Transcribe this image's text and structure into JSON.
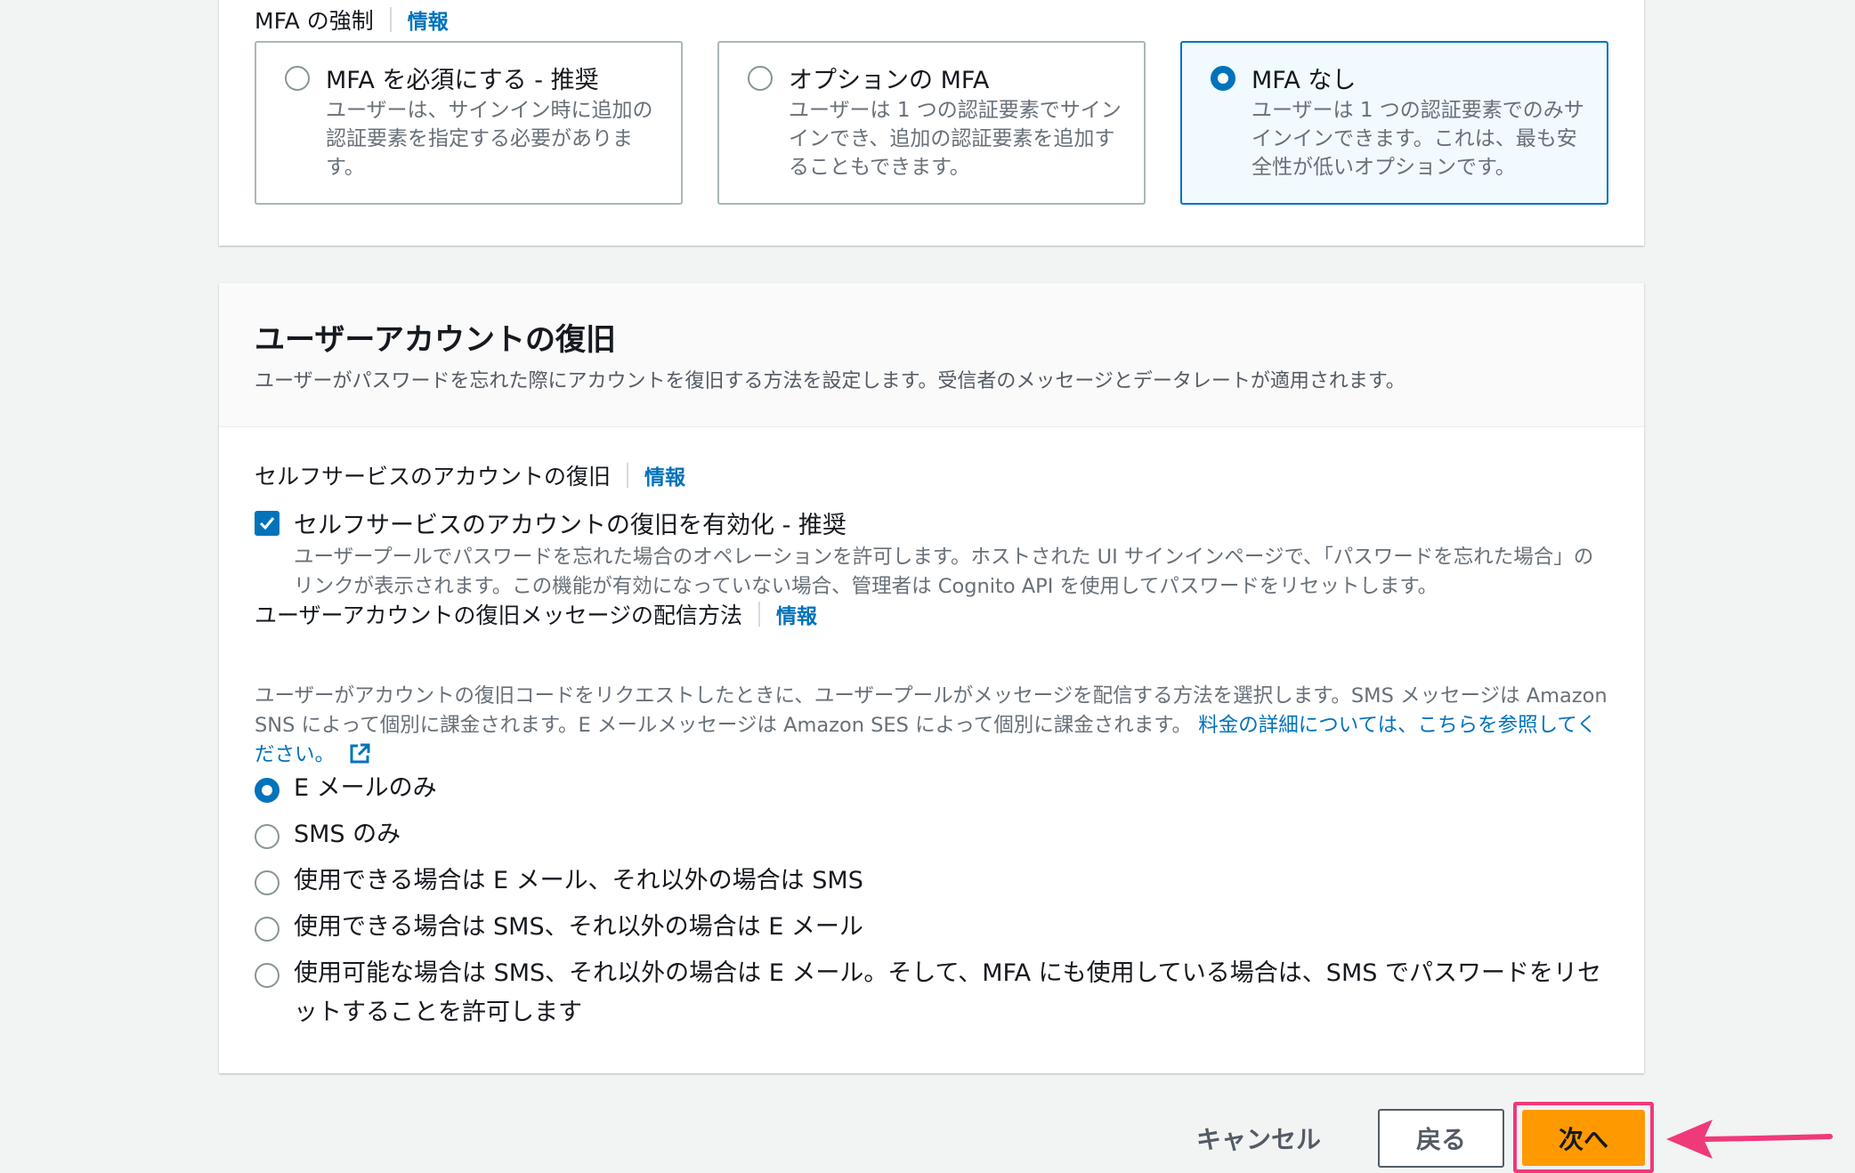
{
  "mfa": {
    "label": "MFA の強制",
    "info": "情報",
    "options": [
      {
        "title": "MFA を必須にする - 推奨",
        "desc": "ユーザーは、サインイン時に追加の認証要素を指定する必要があります。",
        "selected": false
      },
      {
        "title": "オプションの MFA",
        "desc": "ユーザーは 1 つの認証要素でサインインでき、追加の認証要素を追加することもできます。",
        "selected": false
      },
      {
        "title": "MFA なし",
        "desc": "ユーザーは 1 つの認証要素でのみサインインできます。これは、最も安全性が低いオプションです。",
        "selected": true
      }
    ]
  },
  "recovery": {
    "title": "ユーザーアカウントの復旧",
    "description": "ユーザーがパスワードを忘れた際にアカウントを復旧する方法を設定します。受信者のメッセージとデータレートが適用されます。",
    "self_service": {
      "label": "セルフサービスのアカウントの復旧",
      "info": "情報",
      "checkbox_label": "セルフサービスのアカウントの復旧を有効化 - 推奨",
      "checked": true,
      "desc": "ユーザープールでパスワードを忘れた場合のオペレーションを許可します。ホストされた UI サインインページで、「パスワードを忘れた場合」のリンクが表示されます。この機能が有効になっていない場合、管理者は Cognito API を使用してパスワードをリセットします。"
    },
    "delivery": {
      "label": "ユーザーアカウントの復旧メッセージの配信方法",
      "info": "情報",
      "desc": "ユーザーがアカウントの復旧コードをリクエストしたときに、ユーザープールがメッセージを配信する方法を選択します。SMS メッセージは Amazon SNS によって個別に課金されます。E メールメッセージは Amazon SES によって個別に課金されます。",
      "link": "料金の詳細については、こちらを参照してください。",
      "options": [
        {
          "label": "E メールのみ",
          "selected": true
        },
        {
          "label": "SMS のみ",
          "selected": false
        },
        {
          "label": "使用できる場合は E メール、それ以外の場合は SMS",
          "selected": false
        },
        {
          "label": "使用できる場合は SMS、それ以外の場合は E メール",
          "selected": false
        },
        {
          "label": "使用可能な場合は SMS、それ以外の場合は E メール。そして、MFA にも使用している場合は、SMS でパスワードをリセットすることを許可します",
          "selected": false
        }
      ]
    }
  },
  "footer": {
    "cancel": "キャンセル",
    "back": "戻る",
    "next": "次へ"
  },
  "colors": {
    "accent": "#0073bb",
    "primary_button": "#ff9900",
    "highlight": "#f0397a"
  }
}
